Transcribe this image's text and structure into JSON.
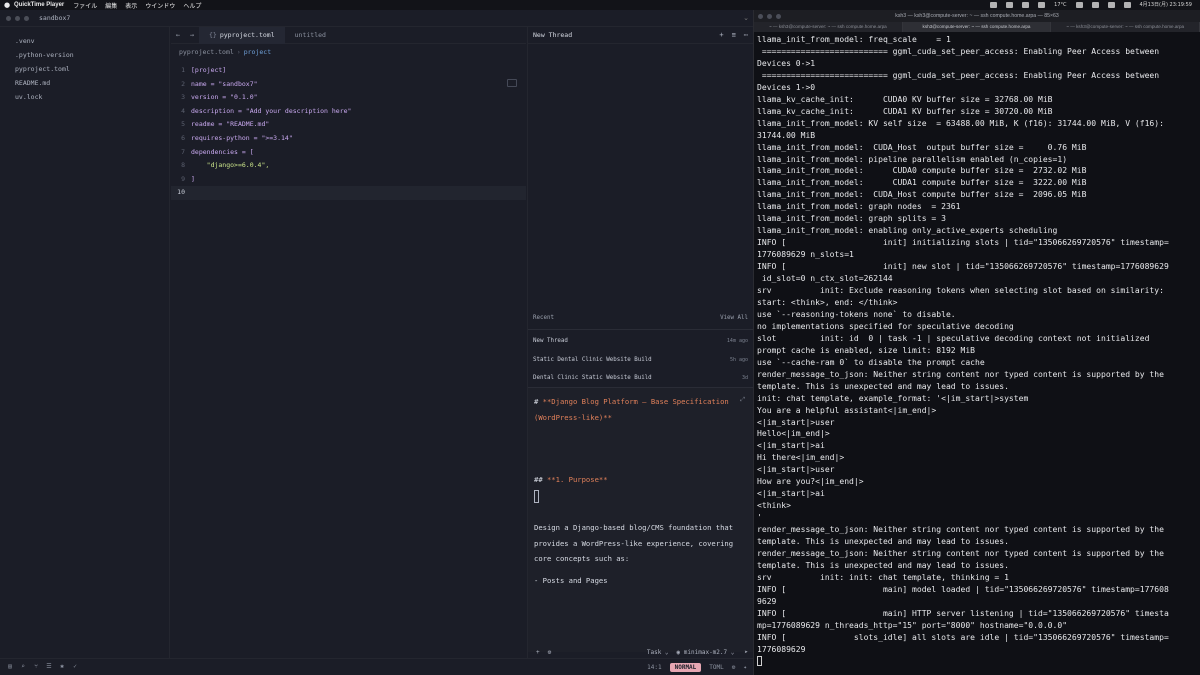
{
  "menubar": {
    "app": "QuickTime Player",
    "items": [
      "ファイル",
      "編集",
      "表示",
      "ウインドウ",
      "ヘルプ"
    ],
    "temp": "17°C",
    "datetime": "4月13日(月) 23:19:59"
  },
  "editor": {
    "project_title": "sandbox7",
    "tree": [
      ".venv",
      ".python-version",
      "pyproject.toml",
      "README.md",
      "uv.lock"
    ],
    "tabs": [
      {
        "label": "pyproject.toml",
        "active": true
      },
      {
        "label": "untitled",
        "active": false
      }
    ],
    "breadcrumb": {
      "file": "pyproject.toml",
      "section": "project"
    },
    "code": [
      {
        "n": "1",
        "text": "[project]"
      },
      {
        "n": "2",
        "text": "name = \"sandbox7\""
      },
      {
        "n": "3",
        "text": "version = \"0.1.0\""
      },
      {
        "n": "4",
        "text": "description = \"Add your description here\""
      },
      {
        "n": "5",
        "text": "readme = \"README.md\""
      },
      {
        "n": "6",
        "text": "requires-python = \">=3.14\""
      },
      {
        "n": "7",
        "text": "dependencies = ["
      },
      {
        "n": "8",
        "text": "    \"django>=6.0.4\","
      },
      {
        "n": "9",
        "text": "]"
      },
      {
        "n": "10",
        "text": ""
      }
    ]
  },
  "agent": {
    "title": "New Thread",
    "recent_label": "Recent",
    "view_all": "View All",
    "threads": [
      {
        "title": "New Thread",
        "time": "14m ago"
      },
      {
        "title": "Static Dental Clinic Website Build",
        "time": "5h ago"
      },
      {
        "title": "Dental Clinic Static Website Build",
        "time": "3d"
      }
    ],
    "draft": {
      "heading_prefix": "# ",
      "heading": "**Django Blog Platform – Base Specification (WordPress-like)**",
      "section_prefix": "## ",
      "section": "**1. Purpose**",
      "body": "Design a Django-based blog/CMS foundation that provides a WordPress-like experience, covering core concepts such as:",
      "bullet": "- Posts and Pages"
    },
    "footer": {
      "mode": "Task",
      "model": "minimax-m2.7"
    }
  },
  "statusbar": {
    "position": "14:1",
    "mode": "NORMAL",
    "language": "TOML"
  },
  "terminal": {
    "title": "ksh3 — ksh3@compute-server: ~ — ssh compute.home.arpa — 85×63",
    "tabs": [
      "~ — ksh3@compute-server: ~ — ssh compute.home.arpa",
      "ksh3@compute-server: ~ — ssh compute.home.arpa",
      "~ — ksh3@compute-server: ~ — ssh compute.home.arpa"
    ],
    "lines": [
      "llama_init_from_model: freq_scale    = 1",
      " ========================== ggml_cuda_set_peer_access: Enabling Peer Access between",
      "Devices 0->1",
      " ========================== ggml_cuda_set_peer_access: Enabling Peer Access between",
      "Devices 1->0",
      "llama_kv_cache_init:      CUDA0 KV buffer size = 32768.00 MiB",
      "llama_kv_cache_init:      CUDA1 KV buffer size = 30720.00 MiB",
      "llama_init_from_model: KV self size  = 63488.00 MiB, K (f16): 31744.00 MiB, V (f16):",
      "31744.00 MiB",
      "llama_init_from_model:  CUDA_Host  output buffer size =     0.76 MiB",
      "llama_init_from_model: pipeline parallelism enabled (n_copies=1)",
      "llama_init_from_model:      CUDA0 compute buffer size =  2732.02 MiB",
      "llama_init_from_model:      CUDA1 compute buffer size =  3222.00 MiB",
      "llama_init_from_model:  CUDA_Host compute buffer size =  2096.05 MiB",
      "llama_init_from_model: graph nodes  = 2361",
      "llama_init_from_model: graph splits = 3",
      "llama_init_from_model: enabling only_active_experts scheduling",
      "INFO [                    init] initializing slots | tid=\"135066269720576\" timestamp=",
      "1776089629 n_slots=1",
      "INFO [                    init] new slot | tid=\"135066269720576\" timestamp=1776089629",
      " id_slot=0 n_ctx_slot=262144",
      "srv          init: Exclude reasoning tokens when selecting slot based on similarity:",
      "start: <think>, end: </think>",
      "use `--reasoning-tokens none` to disable.",
      "no implementations specified for speculative decoding",
      "slot         init: id  0 | task -1 | speculative decoding context not initialized",
      "prompt cache is enabled, size limit: 8192 MiB",
      "use `--cache-ram 0` to disable the prompt cache",
      "render_message_to_json: Neither string content nor typed content is supported by the",
      "template. This is unexpected and may lead to issues.",
      "init: chat template, example_format: '<|im_start|>system",
      "You are a helpful assistant<|im_end|>",
      "<|im_start|>user",
      "Hello<|im_end|>",
      "<|im_start|>ai",
      "Hi there<|im_end|>",
      "<|im_start|>user",
      "How are you?<|im_end|>",
      "<|im_start|>ai",
      "<think>",
      "'",
      "render_message_to_json: Neither string content nor typed content is supported by the",
      "template. This is unexpected and may lead to issues.",
      "render_message_to_json: Neither string content nor typed content is supported by the",
      "template. This is unexpected and may lead to issues.",
      "srv          init: init: chat template, thinking = 1",
      "INFO [                    main] model loaded | tid=\"135066269720576\" timestamp=177608",
      "9629",
      "INFO [                    main] HTTP server listening | tid=\"135066269720576\" timesta",
      "mp=1776089629 n_threads_http=\"15\" port=\"8000\" hostname=\"0.0.0.0\"",
      "INFO [              slots_idle] all slots are idle | tid=\"135066269720576\" timestamp=",
      "1776089629"
    ]
  }
}
